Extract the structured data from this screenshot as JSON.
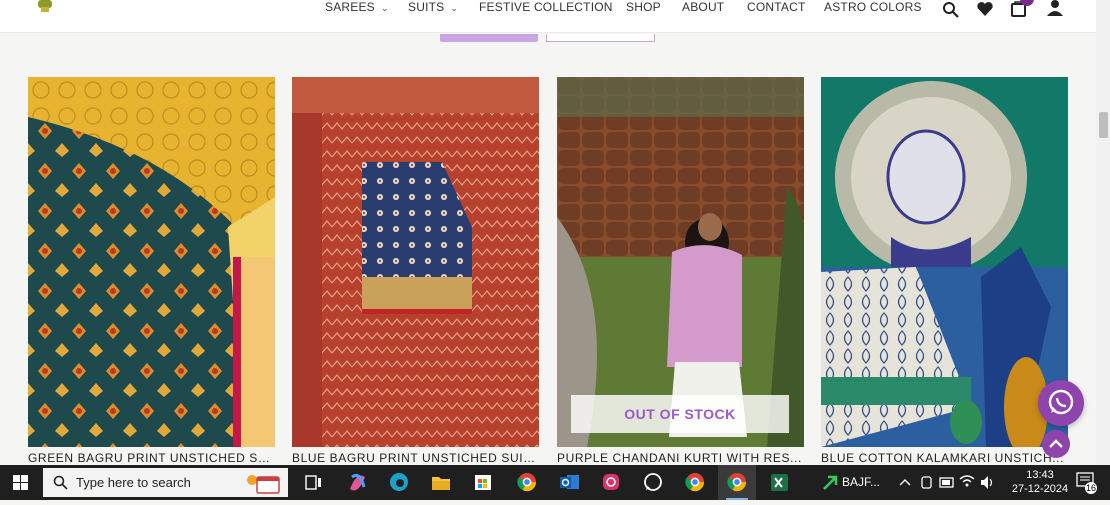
{
  "nav": {
    "items": [
      {
        "label": "SAREES",
        "dropdown": true
      },
      {
        "label": "SUITS",
        "dropdown": true
      },
      {
        "label": "FESTIVE COLLECTION",
        "dropdown": false
      },
      {
        "label": "SHOP",
        "dropdown": false
      },
      {
        "label": "ABOUT",
        "dropdown": false
      },
      {
        "label": "CONTACT",
        "dropdown": false
      },
      {
        "label": "ASTRO COLORS",
        "dropdown": false
      }
    ],
    "chevron": "⌄",
    "icons": [
      "search-icon",
      "heart-icon",
      "cart-icon",
      "user-icon"
    ]
  },
  "products": [
    {
      "title": "GREEN BAGRU PRINT UNSTICHED SU...",
      "out_of_stock": false
    },
    {
      "title": "BLUE BAGRU PRINT UNSTICHED SUIT...",
      "out_of_stock": false
    },
    {
      "title": "PURPLE CHANDANI KURTI WITH RES...",
      "out_of_stock": true
    },
    {
      "title": "BLUE COTTON  KALAMKARI UNSTICH...",
      "out_of_stock": false
    }
  ],
  "labels": {
    "out_of_stock": "OUT OF STOCK"
  },
  "colors": {
    "accent": "#8e44ad",
    "accent_light": "#c7a7e3",
    "oos_text": "#9b59c9"
  },
  "taskbar": {
    "search_placeholder": "Type here to search",
    "app_label": "BAJF...",
    "time": "13:43",
    "date": "27-12-2024",
    "notification_count": "16"
  }
}
